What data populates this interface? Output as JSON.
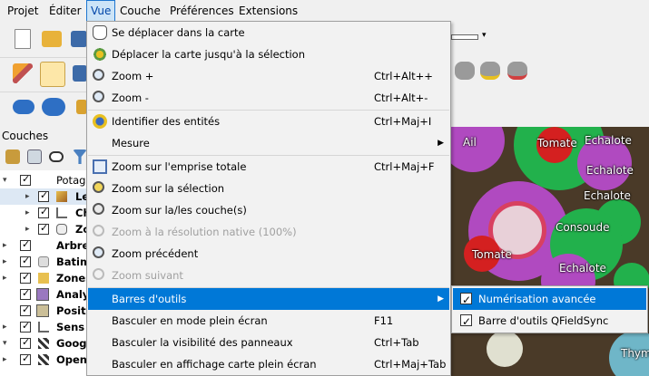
{
  "menubar": {
    "items": [
      {
        "label": "Projet",
        "active": false
      },
      {
        "label": "Éditer",
        "active": false
      },
      {
        "label": "Vue",
        "active": true
      },
      {
        "label": "Couche",
        "active": false
      },
      {
        "label": "Préférences",
        "active": false
      },
      {
        "label": "Extensions",
        "active": false
      }
    ]
  },
  "layers_panel": {
    "title": "Couches",
    "layers": [
      {
        "label": "Potag",
        "checked": true,
        "arrow": "▾",
        "bold": false
      },
      {
        "label": "Le",
        "checked": true,
        "arrow": "▸",
        "bold": true
      },
      {
        "label": "Ch",
        "checked": true,
        "arrow": "▸",
        "bold": true
      },
      {
        "label": "Zo",
        "checked": true,
        "arrow": "▸",
        "bold": true
      },
      {
        "label": "Arbre",
        "checked": true,
        "arrow": "▸",
        "bold": true
      },
      {
        "label": "Batim",
        "checked": true,
        "arrow": "▸",
        "bold": true
      },
      {
        "label": "Zones",
        "checked": true,
        "arrow": "▸",
        "bold": true
      },
      {
        "label": "Analy",
        "checked": true,
        "arrow": "",
        "bold": true
      },
      {
        "label": "Positi",
        "checked": true,
        "arrow": "",
        "bold": true
      },
      {
        "label": "Sens d",
        "checked": true,
        "arrow": "▸",
        "bold": true
      },
      {
        "label": "Goog",
        "checked": true,
        "arrow": "▾",
        "bold": true
      },
      {
        "label": "Open",
        "checked": true,
        "arrow": "▸",
        "bold": true
      }
    ]
  },
  "view_menu": {
    "items": [
      {
        "label": "Se déplacer dans la carte",
        "shortcut": "",
        "icon": "hand-icon",
        "disabled": false
      },
      {
        "label": "Déplacer la carte jusqu'à la sélection",
        "shortcut": "",
        "icon": "pan-to-selection-icon",
        "disabled": false
      },
      {
        "label": "Zoom +",
        "shortcut": "Ctrl+Alt++",
        "icon": "zoom-in-icon",
        "disabled": false
      },
      {
        "label": "Zoom -",
        "shortcut": "Ctrl+Alt+-",
        "icon": "zoom-out-icon",
        "disabled": false
      },
      {
        "label": "Identifier des entités",
        "shortcut": "Ctrl+Maj+I",
        "icon": "identify-icon",
        "disabled": false
      },
      {
        "label": "Mesure",
        "shortcut": "",
        "icon": "",
        "disabled": false,
        "submenu": true
      },
      {
        "label": "Zoom sur l'emprise totale",
        "shortcut": "Ctrl+Maj+F",
        "icon": "zoom-full-icon",
        "disabled": false
      },
      {
        "label": "Zoom sur la sélection",
        "shortcut": "",
        "icon": "zoom-selection-icon",
        "disabled": false
      },
      {
        "label": "Zoom sur la/les couche(s)",
        "shortcut": "",
        "icon": "zoom-layer-icon",
        "disabled": false
      },
      {
        "label": "Zoom à la résolution native (100%)",
        "shortcut": "",
        "icon": "zoom-native-icon",
        "disabled": true
      },
      {
        "label": "Zoom précédent",
        "shortcut": "",
        "icon": "zoom-last-icon",
        "disabled": false
      },
      {
        "label": "Zoom suivant",
        "shortcut": "",
        "icon": "zoom-next-icon",
        "disabled": true
      },
      {
        "label": "Barres d'outils",
        "shortcut": "",
        "icon": "",
        "disabled": false,
        "submenu": true,
        "highlighted": true
      },
      {
        "label": "Basculer en mode plein écran",
        "shortcut": "F11",
        "icon": "",
        "disabled": false
      },
      {
        "label": "Basculer la visibilité des panneaux",
        "shortcut": "Ctrl+Tab",
        "icon": "",
        "disabled": false
      },
      {
        "label": "Basculer en affichage carte plein écran",
        "shortcut": "Ctrl+Maj+Tab",
        "icon": "",
        "disabled": false
      }
    ]
  },
  "toolbars_submenu": {
    "items": [
      {
        "label": "Numérisation avancée",
        "checked": true,
        "highlighted": true
      },
      {
        "label": "Barre d'outils QFieldSync",
        "checked": true,
        "highlighted": false
      }
    ]
  },
  "map": {
    "labels": [
      "Ail",
      "Tomate",
      "Echalote",
      "Echalote",
      "Echalote",
      "Consoude",
      "Tomate",
      "Echalote",
      "Thym"
    ]
  },
  "colors": {
    "accent": "#0078d7",
    "menu_bg": "#f2f2f2",
    "map_bg": "#4a3a28",
    "green_zone": "#22b14c",
    "purple_zone": "#b04ac0",
    "tomato_red": "#d42020"
  }
}
